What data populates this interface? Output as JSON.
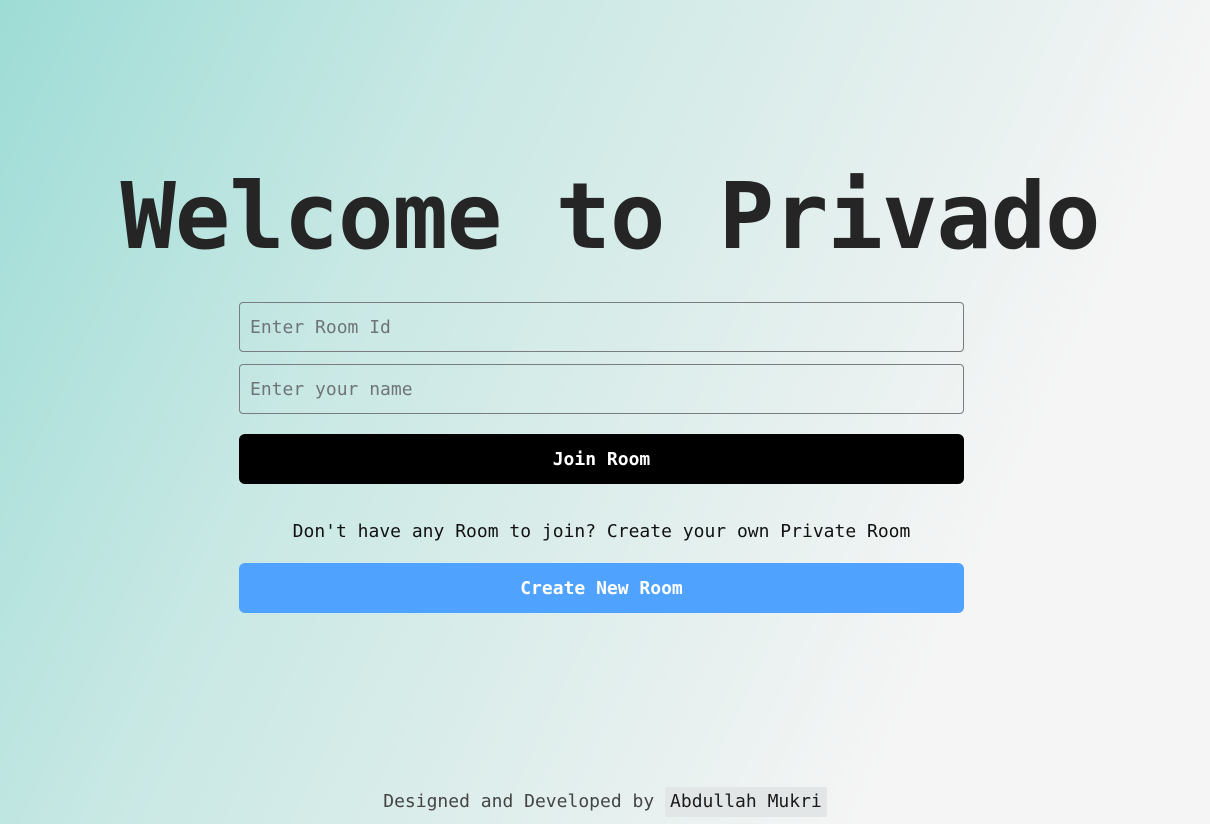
{
  "header": {
    "title": "Welcome to Privado"
  },
  "form": {
    "room_id_placeholder": "Enter Room Id",
    "name_placeholder": "Enter your name",
    "join_label": "Join Room",
    "hint_text": "Don't have any Room to join? Create your own Private Room",
    "create_label": "Create New Room"
  },
  "footer": {
    "prefix": "Designed and Developed by",
    "author": "Abdullah Mukri"
  },
  "colors": {
    "join_button": "#000000",
    "create_button": "#4fa3ff",
    "gradient_start": "#9edcd6",
    "gradient_end": "#f5f5f5"
  }
}
